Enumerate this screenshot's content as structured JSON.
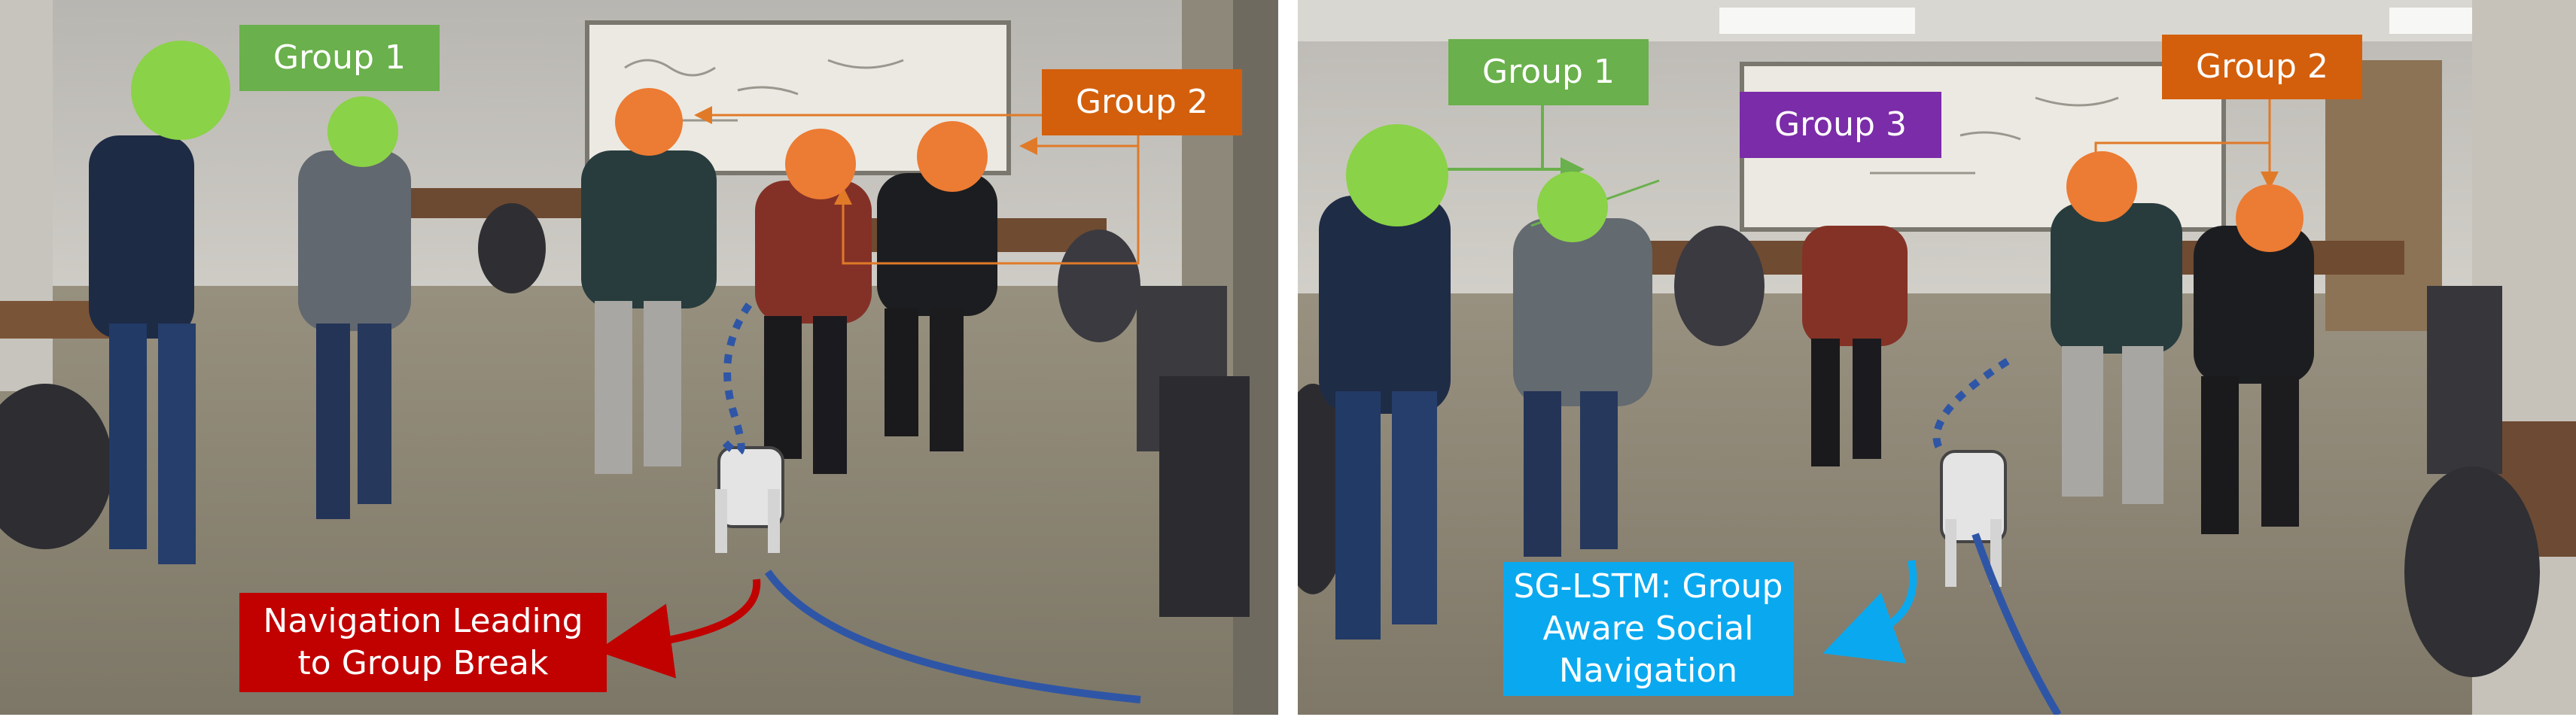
{
  "figure": {
    "left_panel": {
      "labels": {
        "group1": "Group 1",
        "group2": "Group 2",
        "caption": "Navigation Leading\nto Group Break"
      },
      "colors": {
        "group1": "#6ab04c",
        "group2": "#d35f0c",
        "caption": "#c10000",
        "path": "#2f56a6"
      }
    },
    "right_panel": {
      "labels": {
        "group1": "Group 1",
        "group2": "Group 2",
        "group3": "Group 3",
        "caption": "SG-LSTM: Group\nAware Social\nNavigation"
      },
      "colors": {
        "group1": "#6ab04c",
        "group2": "#d35f0c",
        "group3": "#7b2ca8",
        "caption": "#0aa9ef",
        "path": "#2f56a6"
      }
    }
  }
}
